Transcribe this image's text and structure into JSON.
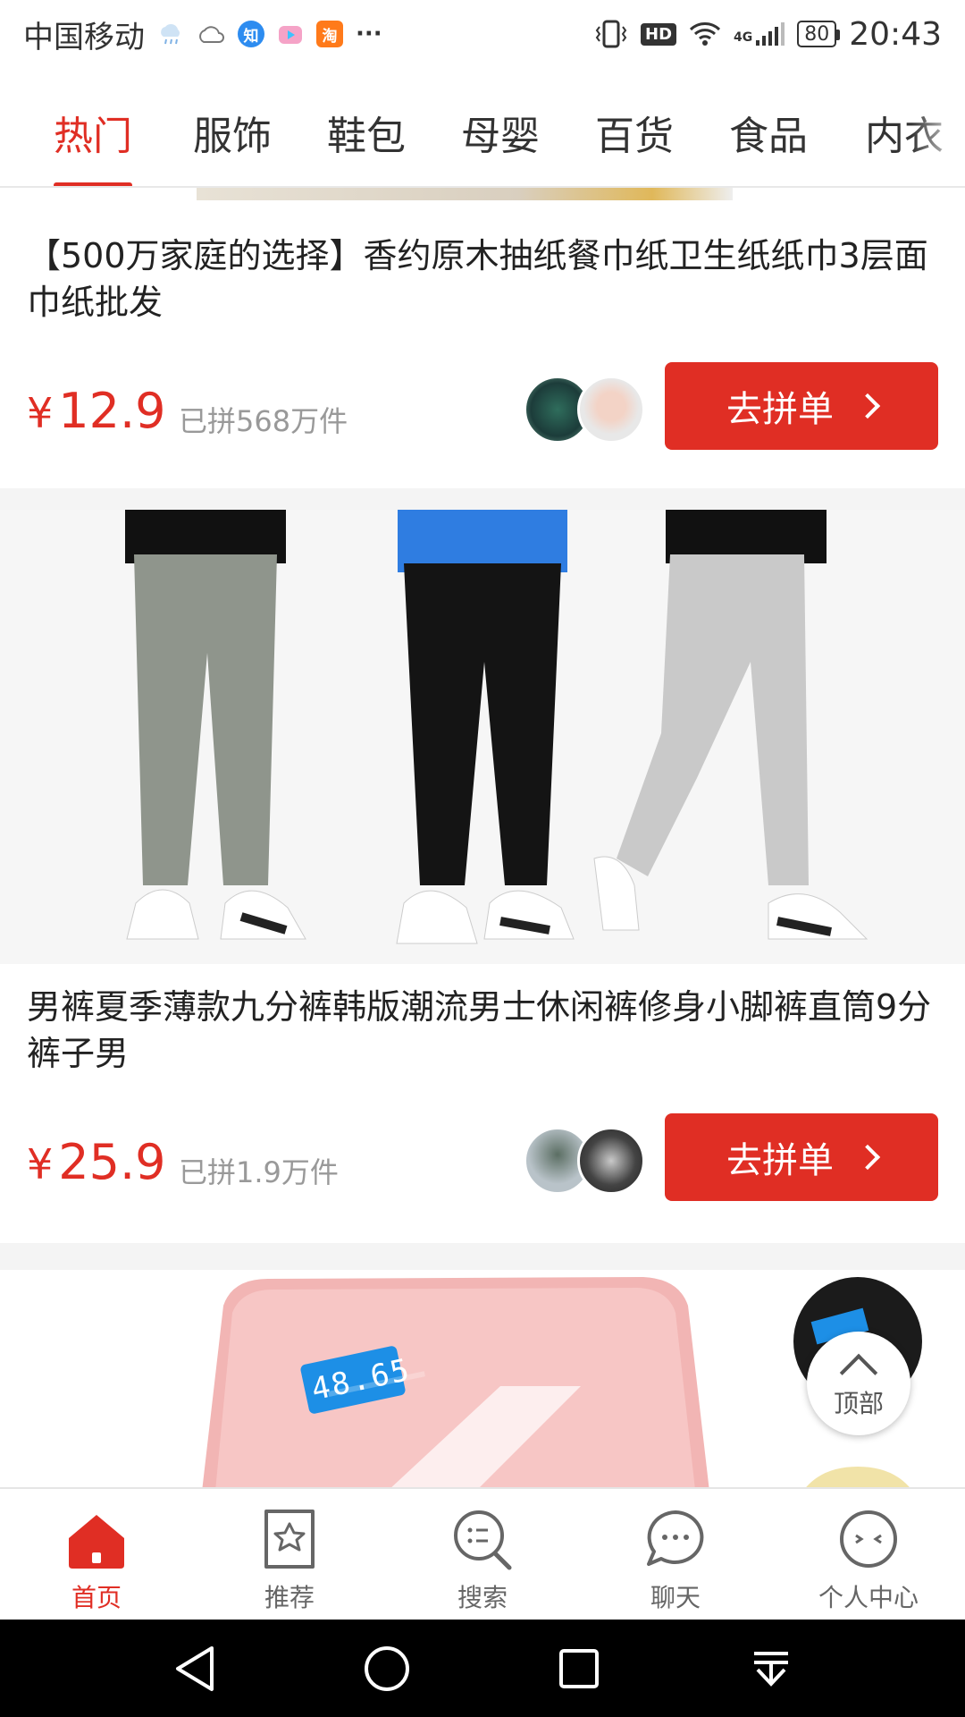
{
  "status_bar": {
    "carrier": "中国移动",
    "zhihu_badge": "知",
    "taobao_badge": "淘",
    "more": "···",
    "hd": "HD",
    "network": "4G",
    "battery": "80",
    "time": "20:43"
  },
  "tabs": [
    {
      "label": "热门",
      "active": true
    },
    {
      "label": "服饰"
    },
    {
      "label": "鞋包"
    },
    {
      "label": "母婴"
    },
    {
      "label": "百货"
    },
    {
      "label": "食品"
    },
    {
      "label": "内衣"
    }
  ],
  "products": [
    {
      "title": "【500万家庭的选择】香约原木抽纸餐巾纸卫生纸纸巾3层面巾纸批发",
      "currency": "¥",
      "price": "12.9",
      "sold": "已拼568万件",
      "button": "去拼单"
    },
    {
      "title": "男裤夏季薄款九分裤韩版潮流男士休闲裤修身小脚裤直筒9分裤子男",
      "currency": "¥",
      "price": "25.9",
      "sold": "已拼1.9万件",
      "button": "去拼单"
    }
  ],
  "scale_display": "48.65",
  "back_to_top": "顶部",
  "bottom_nav": [
    {
      "label": "首页",
      "icon": "home-icon",
      "active": true
    },
    {
      "label": "推荐",
      "icon": "star-bookmark-icon"
    },
    {
      "label": "搜索",
      "icon": "search-icon"
    },
    {
      "label": "聊天",
      "icon": "chat-bubble-icon"
    },
    {
      "label": "个人中心",
      "icon": "profile-face-icon"
    }
  ],
  "colors": {
    "accent": "#e02e24",
    "text": "#222222",
    "muted": "#999999",
    "divider": "#f4f4f4"
  }
}
